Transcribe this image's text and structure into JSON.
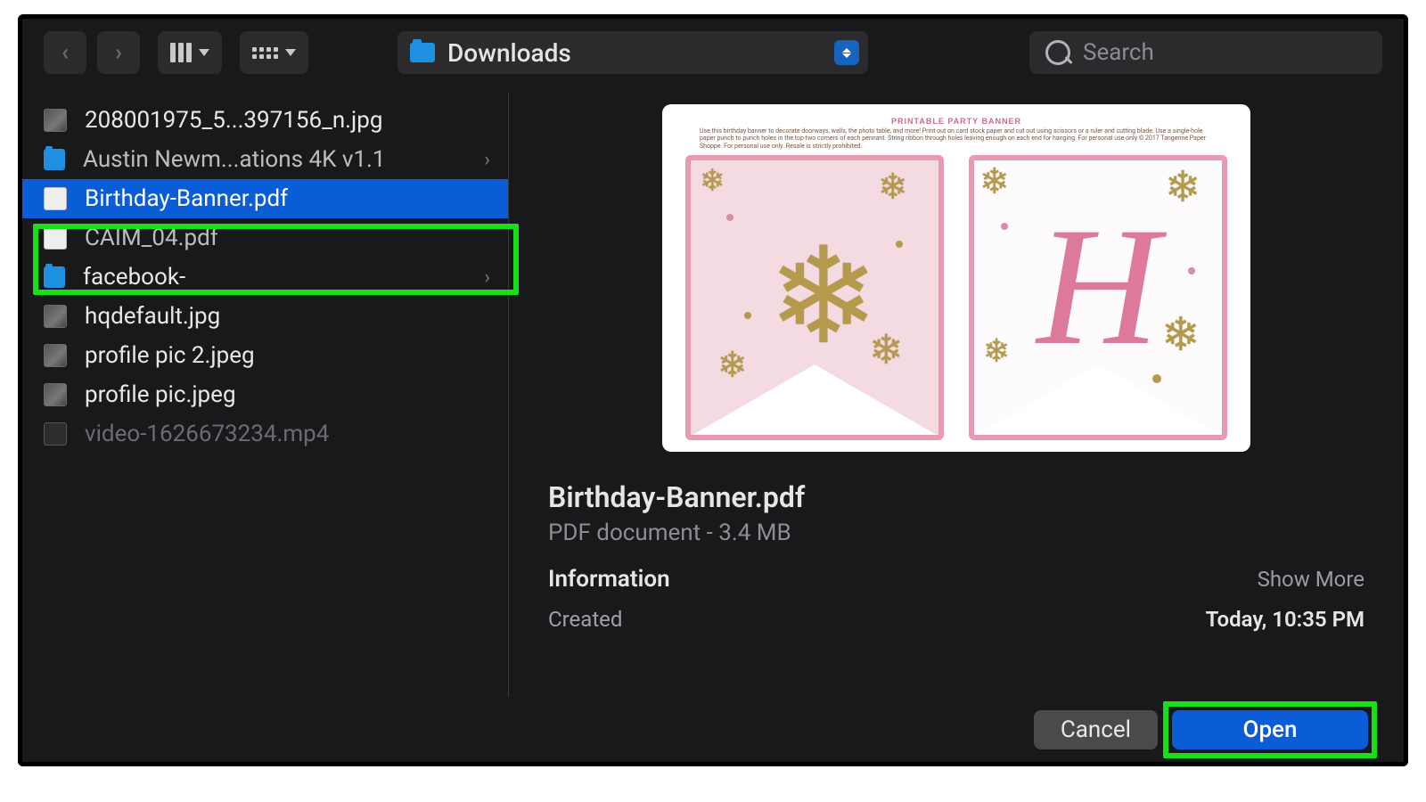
{
  "toolbar": {
    "location_label": "Downloads",
    "search_placeholder": "Search"
  },
  "files": [
    {
      "name": "208001975_5...397156_n.jpg",
      "type": "img"
    },
    {
      "name": "Austin Newm...ations 4K v1.1",
      "type": "folder",
      "expandable": true,
      "cut": true
    },
    {
      "name": "Birthday-Banner.pdf",
      "type": "pdf",
      "selected": true
    },
    {
      "name": "CAIM_04.pdf",
      "type": "pdf",
      "cut": true
    },
    {
      "name": "facebook-",
      "type": "folder",
      "expandable": true
    },
    {
      "name": "hqdefault.jpg",
      "type": "img"
    },
    {
      "name": "profile pic 2.jpeg",
      "type": "img"
    },
    {
      "name": "profile pic.jpeg",
      "type": "img"
    },
    {
      "name": "video-1626673234.mp4",
      "type": "vid",
      "dim": true
    }
  ],
  "preview": {
    "filename": "Birthday-Banner.pdf",
    "filetype_line": "PDF document - 3.4 MB",
    "info_heading": "Information",
    "show_more": "Show More",
    "created_label": "Created",
    "created_value": "Today, 10:35 PM",
    "doc_title": "PRINTABLE PARTY BANNER",
    "doc_blurb": "Use this birthday banner to decorate doorways, walls, the photo table, and more! Print out on card stock paper and cut out using scissors or a ruler and cutting blade. Use a single-hole paper punch to punch holes in the top two corners of each pennant. String ribbon through holes leaving enough on each end for hanging. For personal use only © 2017 Tangerine Paper Shoppe. For personal use only. Resale is strictly prohibited."
  },
  "buttons": {
    "cancel": "Cancel",
    "open": "Open"
  },
  "colors": {
    "highlight_green": "#16e016",
    "selection_blue": "#0a5cd7"
  }
}
